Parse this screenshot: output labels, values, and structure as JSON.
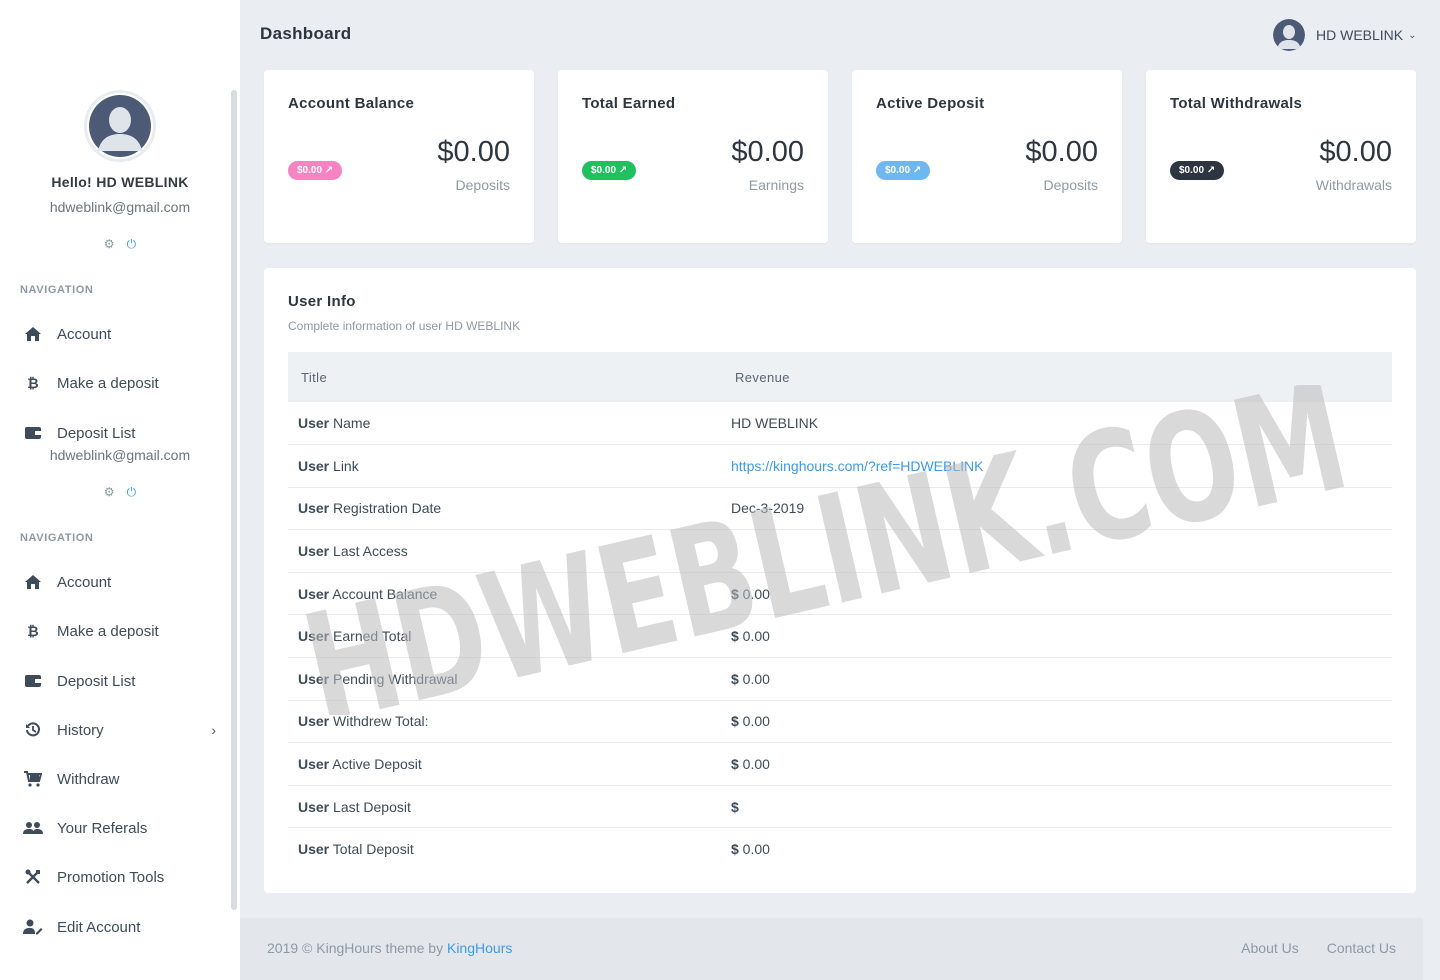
{
  "sidebar": {
    "hello": "Hello! HD WEBLINK",
    "email": "hdweblink@gmail.com",
    "email_repeat": "hdweblink@gmail.com",
    "nav_heading_1": "NAVIGATION",
    "nav_heading_2": "NAVIGATION",
    "items_1": [
      {
        "label": "Account",
        "icon": "home-icon"
      },
      {
        "label": "Make a deposit",
        "icon": "bitcoin-icon"
      },
      {
        "label": "Deposit List",
        "icon": "wallet-icon"
      }
    ],
    "items_2": [
      {
        "label": "Account",
        "icon": "home-icon"
      },
      {
        "label": "Make a deposit",
        "icon": "bitcoin-icon"
      },
      {
        "label": "Deposit List",
        "icon": "wallet-icon"
      },
      {
        "label": "History",
        "icon": "history-icon"
      },
      {
        "label": "Withdraw",
        "icon": "cart-icon"
      },
      {
        "label": "Your Referals",
        "icon": "users-icon"
      },
      {
        "label": "Promotion Tools",
        "icon": "tools-icon"
      },
      {
        "label": "Edit Account",
        "icon": "user-edit-icon"
      }
    ]
  },
  "header": {
    "title": "Dashboard",
    "username": "HD WEBLINK"
  },
  "cards": [
    {
      "title": "Account Balance",
      "badge": "$0.00",
      "badge_color": "#f783c3",
      "value": "$0.00",
      "sub": "Deposits"
    },
    {
      "title": "Total Earned",
      "badge": "$0.00",
      "badge_color": "#20c05f",
      "value": "$0.00",
      "sub": "Earnings"
    },
    {
      "title": "Active Deposit",
      "badge": "$0.00",
      "badge_color": "#6fb7f3",
      "value": "$0.00",
      "sub": "Deposits"
    },
    {
      "title": "Total Withdrawals",
      "badge": "$0.00",
      "badge_color": "#2d3640",
      "value": "$0.00",
      "sub": "Withdrawals"
    }
  ],
  "user_info": {
    "title": "User Info",
    "subtitle": "Complete information of user HD WEBLINK",
    "columns": [
      "Title",
      "Revenue"
    ],
    "rows": [
      {
        "bold": "User",
        "label": " Name",
        "value": "HD WEBLINK",
        "link": false
      },
      {
        "bold": "User",
        "label": " Link",
        "value": "https://kinghours.com/?ref=HDWEBLINK",
        "link": true
      },
      {
        "bold": "User",
        "label": " Registration Date",
        "value": "Dec-3-2019",
        "link": false
      },
      {
        "bold": "User",
        "label": " Last Access",
        "value": "",
        "link": false
      },
      {
        "bold": "User",
        "label": " Account Balance",
        "value_bold": "$",
        "value": " 0.00",
        "link": false
      },
      {
        "bold": "User",
        "label": " Earned Total",
        "value_bold": "$",
        "value": " 0.00",
        "link": false
      },
      {
        "bold": "User",
        "label": " Pending Withdrawal",
        "value_bold": "$",
        "value": " 0.00",
        "link": false
      },
      {
        "bold": "User",
        "label": " Withdrew Total:",
        "value_bold": "$",
        "value": " 0.00",
        "link": false
      },
      {
        "bold": "User",
        "label": " Active Deposit",
        "value_bold": "$",
        "value": " 0.00",
        "link": false
      },
      {
        "bold": "User",
        "label": " Last Deposit",
        "value_bold": "$",
        "value": "",
        "link": false
      },
      {
        "bold": "User",
        "label": " Total Deposit",
        "value_bold": "$",
        "value": " 0.00",
        "link": false
      }
    ]
  },
  "footer": {
    "copyright": "2019 © KingHours theme by ",
    "brand_link": "KingHours",
    "links": [
      "About Us",
      "Contact Us"
    ]
  },
  "watermark": "HDWEBLINK.COM"
}
